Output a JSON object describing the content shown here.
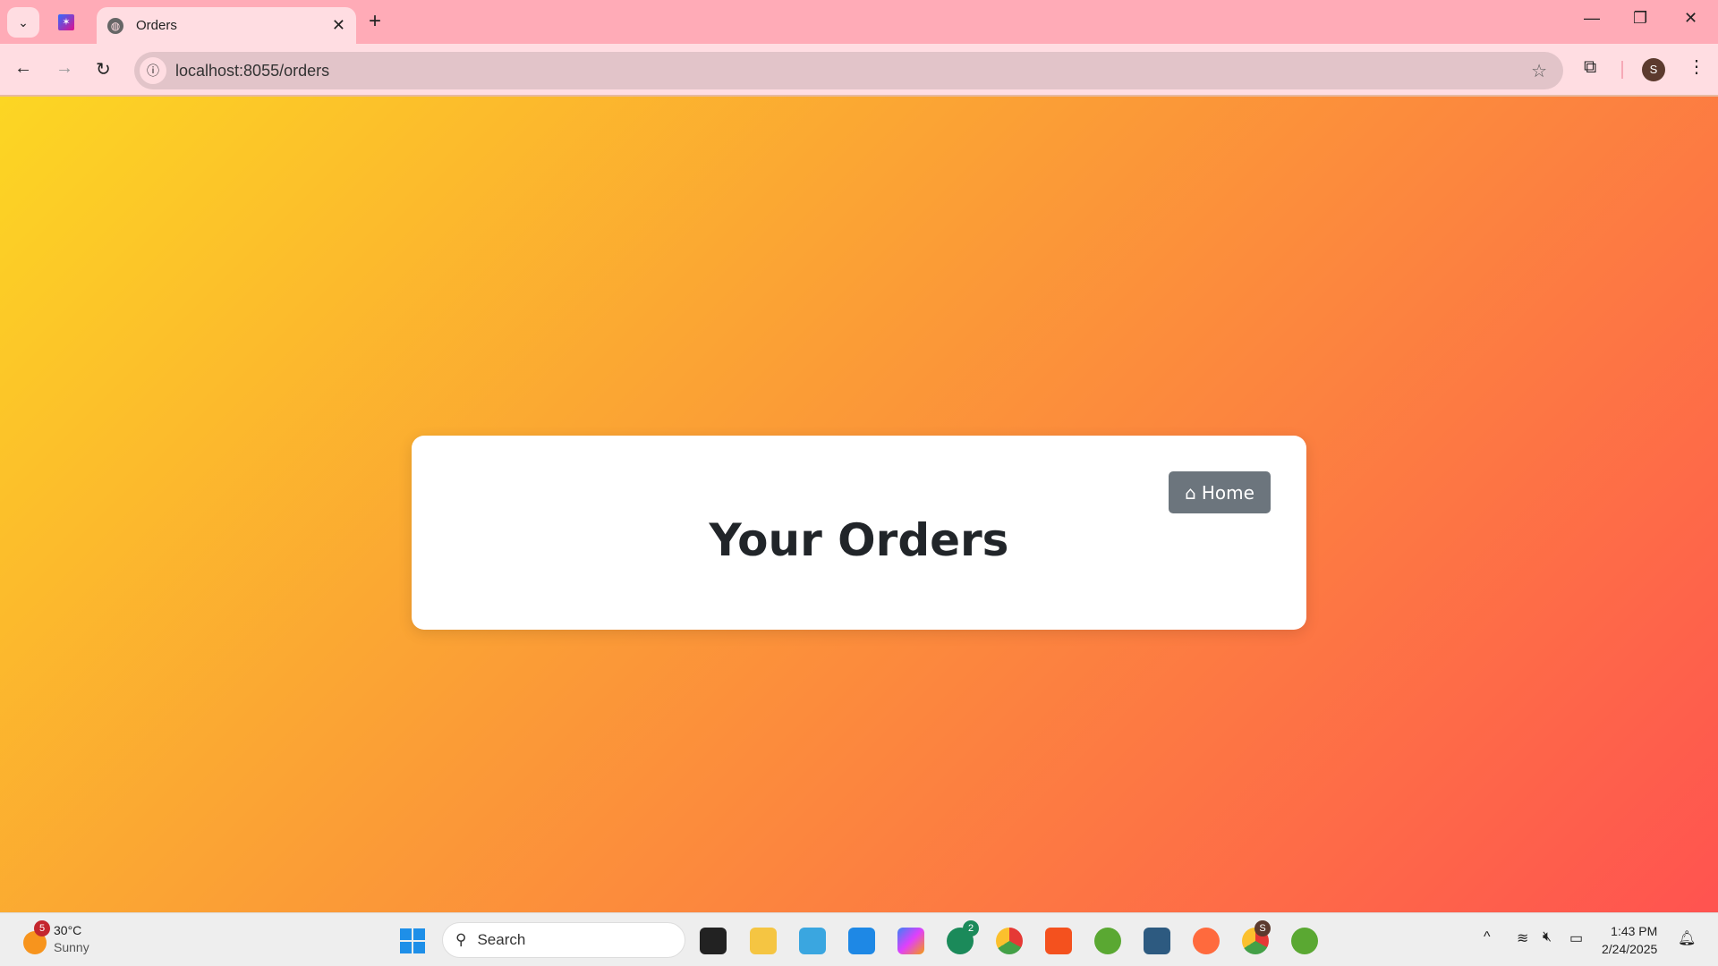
{
  "browser": {
    "tab_title": "Orders",
    "url": "localhost:8055/orders",
    "profile_initial": "S"
  },
  "page": {
    "heading": "Your Orders",
    "home_button_label": "Home",
    "gradient_colors": [
      "#fcd623",
      "#fb9a37",
      "#ff5350"
    ],
    "button_color": "#6c757d"
  },
  "taskbar": {
    "weather_temp": "30°C",
    "weather_condition": "Sunny",
    "weather_badge": "5",
    "search_placeholder": "Search",
    "whatsapp_badge": "2",
    "chrome_profile_badge": "S",
    "time": "1:43 PM",
    "date": "2/24/2025"
  }
}
